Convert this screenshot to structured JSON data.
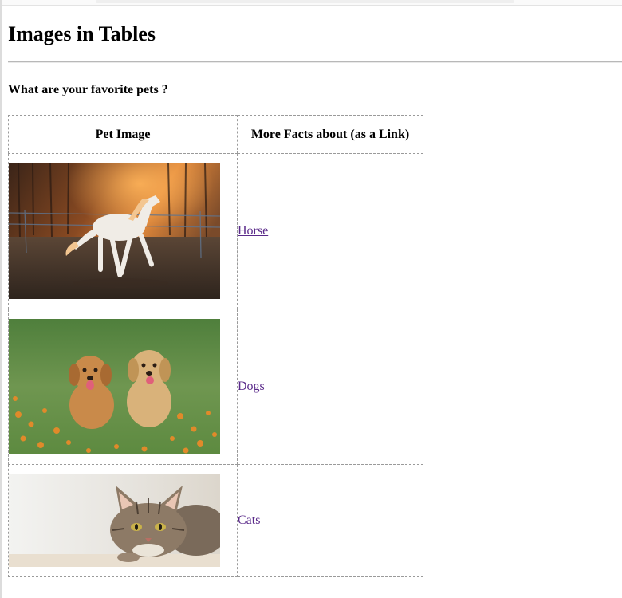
{
  "page": {
    "heading": "Images in Tables",
    "question": "What are your favorite pets ?"
  },
  "table": {
    "headers": {
      "image": "Pet Image",
      "link": "More Facts about (as a Link)"
    },
    "rows": [
      {
        "image": "horse-photo",
        "link_label": "Horse"
      },
      {
        "image": "dogs-photo",
        "link_label": "Dogs"
      },
      {
        "image": "cat-photo",
        "link_label": "Cats"
      }
    ]
  },
  "colors": {
    "link_visited": "#5a2a8a",
    "border": "#9a9a9a"
  }
}
